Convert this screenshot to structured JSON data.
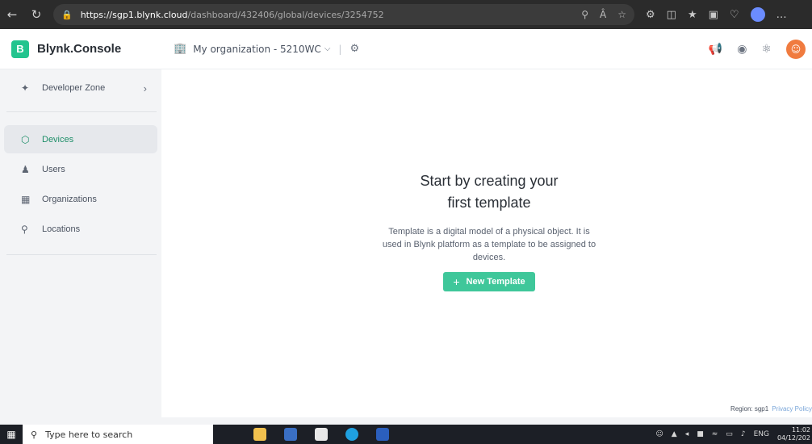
{
  "browser": {
    "url_host": "https://sgp1.blynk.cloud",
    "url_path": "/dashboard/432406/global/devices/3254752"
  },
  "header": {
    "brand_letter": "B",
    "brand_name": "Blynk.Console",
    "organization": "My organization - 5210WC"
  },
  "sidebar": {
    "developer_zone": "Developer Zone",
    "items": [
      {
        "label": "Devices",
        "active": true
      },
      {
        "label": "Users"
      },
      {
        "label": "Organizations"
      },
      {
        "label": "Locations"
      }
    ]
  },
  "main": {
    "title": "Start by creating your first template",
    "description": "Template is a digital model of a physical object. It is used in Blynk platform as a template to be assigned to devices.",
    "new_template_button": "New Template",
    "region": "Region: sgp1",
    "privacy": "Privacy Policy"
  },
  "taskbar": {
    "search_placeholder": "Type here to search",
    "language": "ENG",
    "time": "11:02",
    "date": "04/12/202"
  },
  "colors": {
    "accent": "#23c48e",
    "button": "#3fc79a"
  }
}
